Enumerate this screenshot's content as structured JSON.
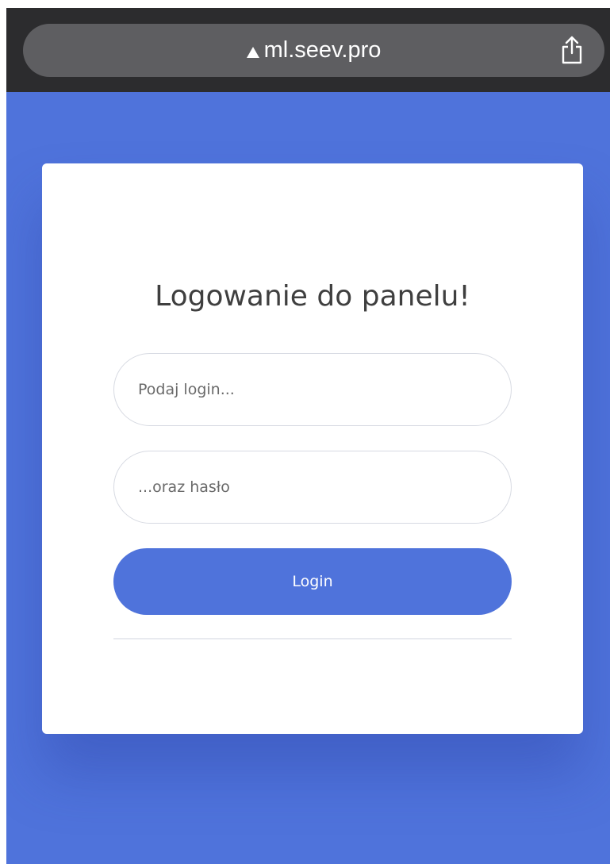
{
  "browser": {
    "url": "ml.seev.pro",
    "warning_icon": "warning-triangle-icon",
    "share_icon": "share-icon"
  },
  "colors": {
    "background": "#4f73db",
    "accent": "#4f73db",
    "toolbar": "#2c2c2e"
  },
  "login_card": {
    "title": "Logowanie do panelu!",
    "login_placeholder": "Podaj login...",
    "password_placeholder": "...oraz hasło",
    "login_value": "",
    "password_value": "",
    "submit_label": "Login"
  }
}
